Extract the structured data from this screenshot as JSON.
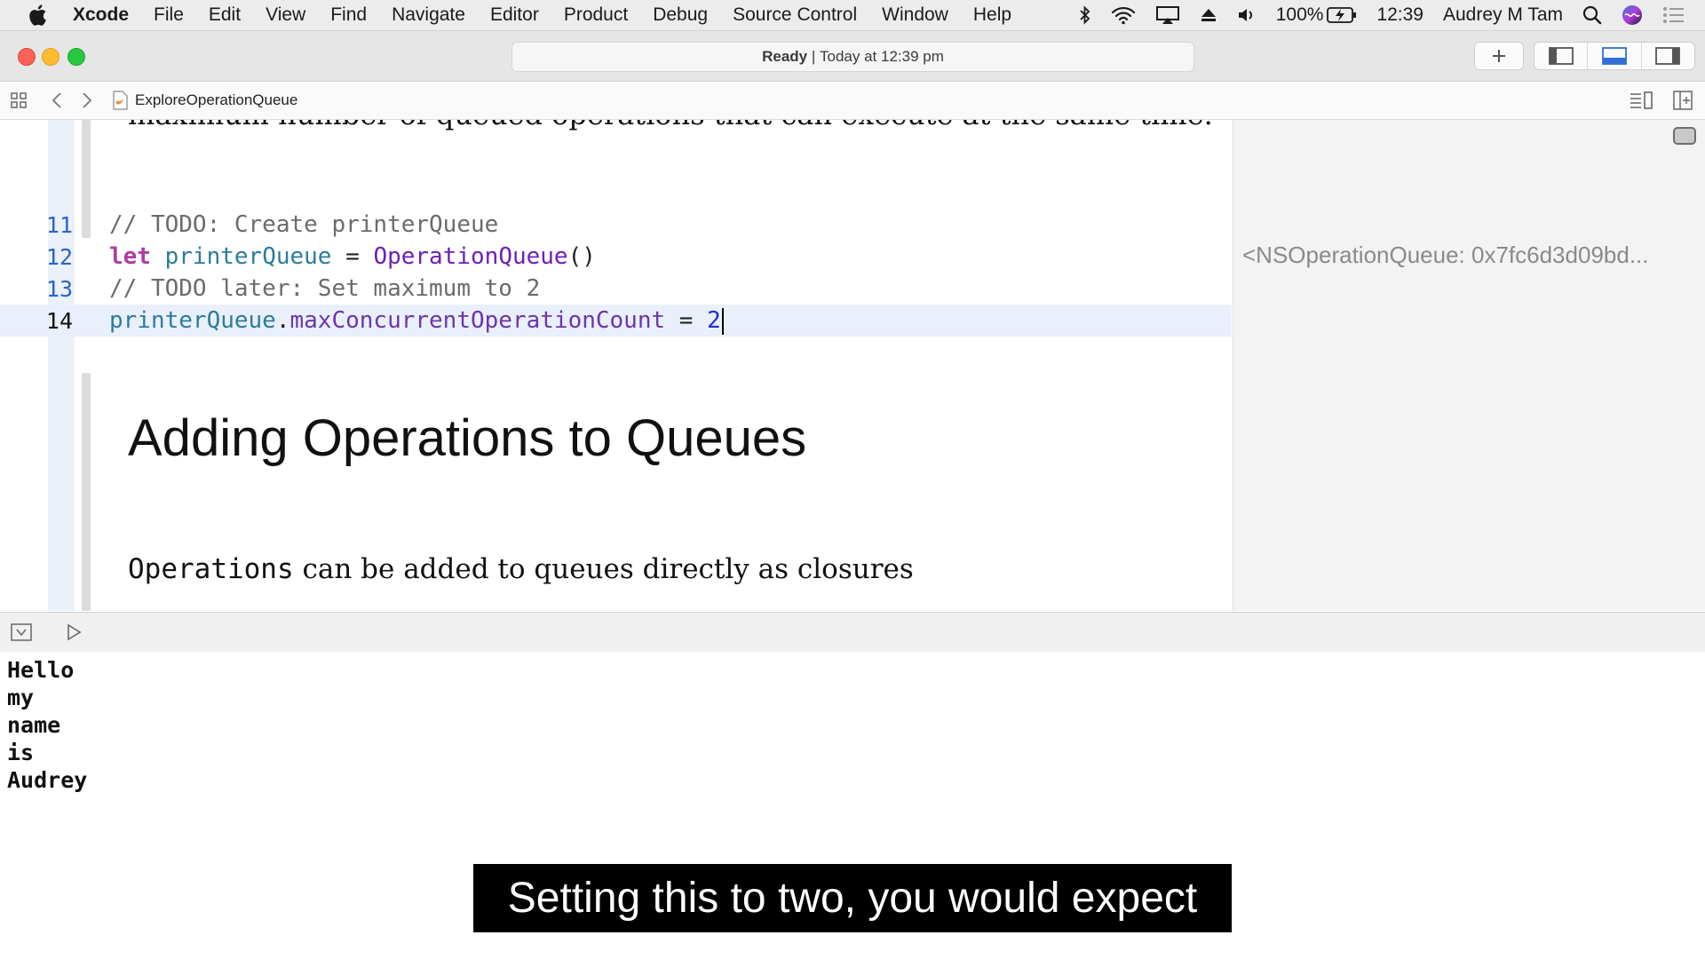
{
  "menubar": {
    "app_name": "Xcode",
    "items": [
      "File",
      "Edit",
      "View",
      "Find",
      "Navigate",
      "Editor",
      "Product",
      "Debug",
      "Source Control",
      "Window",
      "Help"
    ],
    "battery": "100%",
    "clock": "12:39",
    "user": "Audrey M Tam"
  },
  "toolbar": {
    "status_ready": "Ready",
    "status_separator": " | ",
    "status_time": "Today at 12:39 pm"
  },
  "jumpbar": {
    "file": "ExploreOperationQueue"
  },
  "editor": {
    "prose_top": "maximum number of queued operations that can execute at the same time.",
    "lines": [
      {
        "num": "11",
        "text": "// TODO: Create printerQueue"
      },
      {
        "num": "12",
        "kw": "let",
        "var": "printerQueue",
        "eq": " = ",
        "type": "OperationQueue",
        "paren": "()"
      },
      {
        "num": "13",
        "text": "// TODO later: Set maximum to 2"
      },
      {
        "num": "14",
        "var": "printerQueue",
        "dot": ".",
        "prop": "maxConcurrentOperationCount",
        "eq": " = ",
        "num_val": "2"
      }
    ],
    "heading": "Adding Operations to Queues",
    "para_code": "Operations",
    "para_text": " can be added to queues directly as closures"
  },
  "results": {
    "value": "<NSOperationQueue: 0x7fc6d3d09bd..."
  },
  "console": {
    "lines": [
      "Hello",
      "my",
      "name",
      "is",
      "Audrey"
    ]
  },
  "caption": {
    "text": "Setting this to two, you would expect"
  },
  "colors": {
    "keyword": "#ad3da4",
    "variable": "#2c7c9a",
    "type": "#6e1fb5",
    "number": "#1c2fd6",
    "comment": "#6b6b6b",
    "line_number": "#2a64c5"
  }
}
